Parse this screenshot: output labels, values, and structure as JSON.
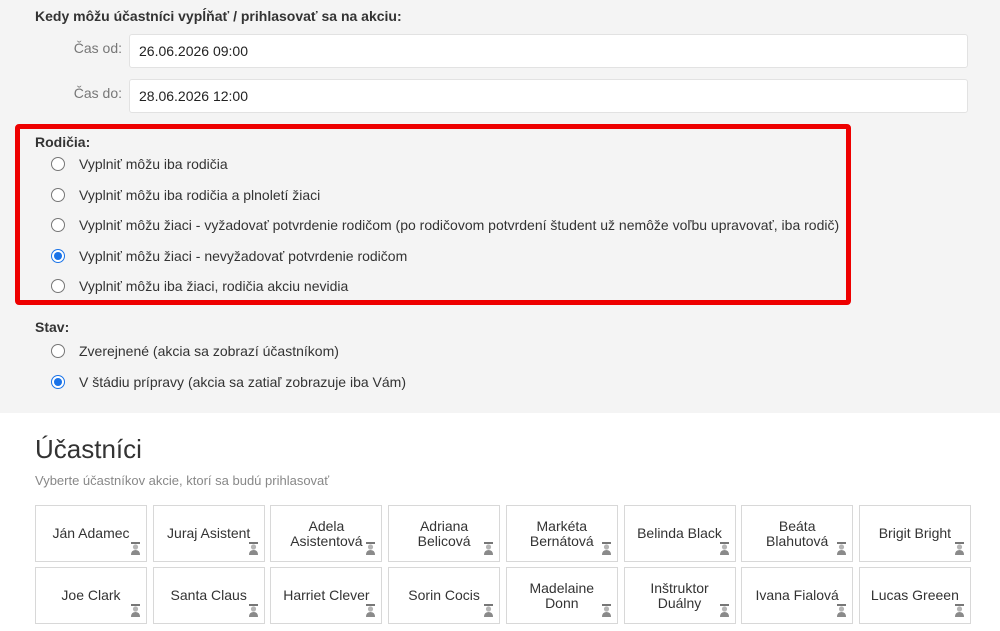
{
  "time_section": {
    "title": "Kedy môžu účastníci vypĺňať / prihlasovať sa na akciu:",
    "from_label": "Čas od:",
    "from_value": "26.06.2026 09:00",
    "to_label": "Čas do:",
    "to_value": "28.06.2026 12:00"
  },
  "parents_section": {
    "title": "Rodičia:",
    "options": [
      {
        "label": "Vyplniť môžu iba rodičia",
        "checked": false
      },
      {
        "label": "Vyplniť môžu iba rodičia a plnoletí žiaci",
        "checked": false
      },
      {
        "label": "Vyplniť môžu žiaci - vyžadovať potvrdenie rodičom (po rodičovom potvrdení študent už nemôže voľbu upravovať, iba rodič)",
        "checked": false
      },
      {
        "label": "Vyplniť môžu žiaci - nevyžadovať potvrdenie rodičom",
        "checked": true
      },
      {
        "label": "Vyplniť môžu iba žiaci, rodičia akciu nevidia",
        "checked": false
      }
    ]
  },
  "status_section": {
    "title": "Stav:",
    "options": [
      {
        "label": "Zverejnené (akcia sa zobrazí účastníkom)",
        "checked": false
      },
      {
        "label": "V štádiu prípravy (akcia sa zatiaľ zobrazuje iba Vám)",
        "checked": true
      }
    ]
  },
  "participants": {
    "title": "Účastníci",
    "subtitle": "Vyberte účastníkov akcie, ktorí sa budú prihlasovať",
    "people": [
      "Ján Adamec",
      "Juraj Asistent",
      "Adela Asistentová",
      "Adriana Belicová",
      "Markéta Bernátová",
      "Belinda Black",
      "Beáta Blahutová",
      "Brigit Bright",
      "Joe Clark",
      "Santa Claus",
      "Harriet Clever",
      "Sorin Cocis",
      "Madelaine Donn",
      "Inštruktor Duálny",
      "Ivana Fialová",
      "Lucas Greeen"
    ],
    "tile_icon": "person-icon"
  },
  "colors": {
    "highlight": "#ee0000",
    "radio_checked": "#1a73e8"
  }
}
